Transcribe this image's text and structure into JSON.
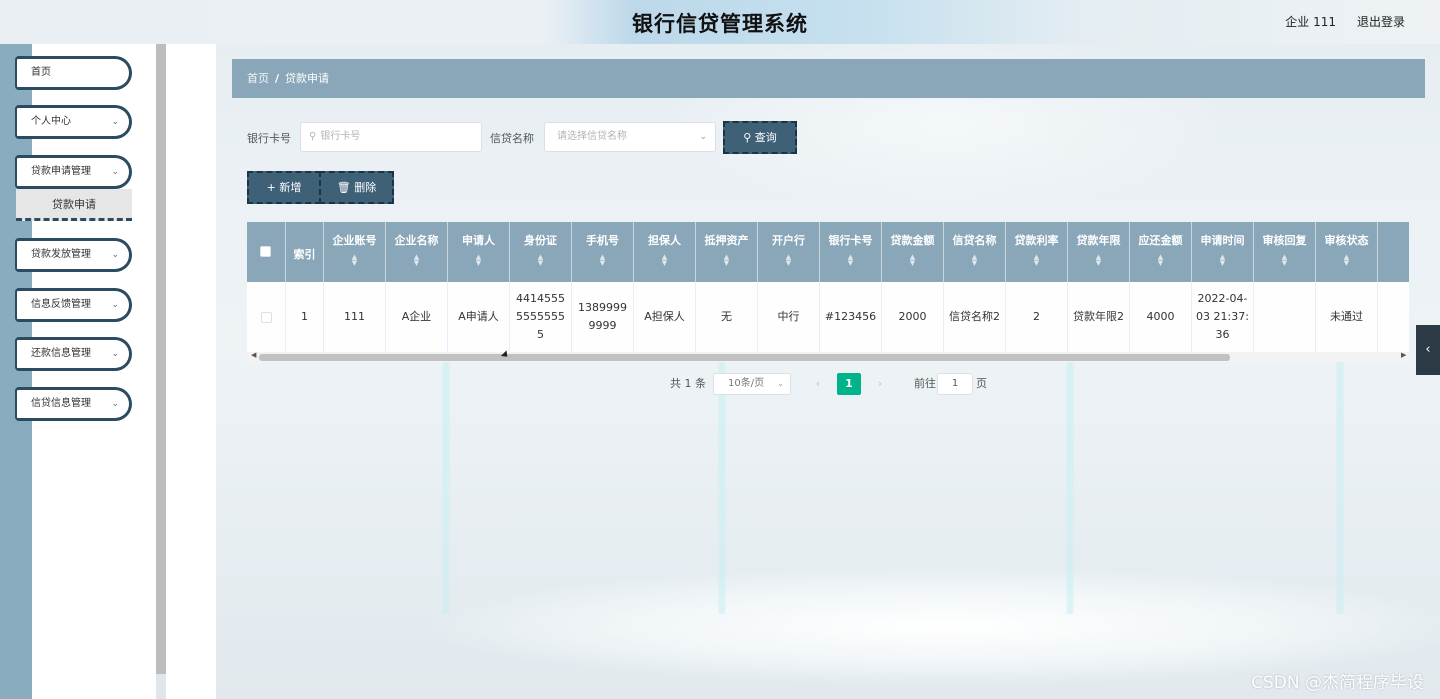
{
  "header": {
    "title": "银行信贷管理系统",
    "user": "企业 111",
    "logout": "退出登录"
  },
  "sidebar": {
    "items": [
      {
        "label": "首页",
        "chevron": false
      },
      {
        "label": "个人中心",
        "chevron": true
      },
      {
        "label": "贷款申请管理",
        "chevron": true
      },
      {
        "label": "贷款发放管理",
        "chevron": true
      },
      {
        "label": "信息反馈管理",
        "chevron": true
      },
      {
        "label": "还款信息管理",
        "chevron": true
      },
      {
        "label": "信贷信息管理",
        "chevron": true
      }
    ],
    "active_sub": "贷款申请"
  },
  "breadcrumb": {
    "home": "首页",
    "separator": "/",
    "current": "贷款申请"
  },
  "search": {
    "card_label": "银行卡号",
    "card_placeholder": "银行卡号",
    "credit_label": "信贷名称",
    "credit_placeholder": "请选择信贷名称",
    "query_button": "查询",
    "add_button": "新增",
    "delete_button": "删除"
  },
  "table": {
    "headers": [
      "索引",
      "企业账号",
      "企业名称",
      "申请人",
      "身份证",
      "手机号",
      "担保人",
      "抵押资产",
      "开户行",
      "银行卡号",
      "贷款金额",
      "信贷名称",
      "贷款利率",
      "贷款年限",
      "应还金额",
      "申请时间",
      "审核回复",
      "审核状态"
    ],
    "rows": [
      [
        "1",
        "111",
        "A企业",
        "A申请人",
        "441455555555555",
        "13899999999",
        "A担保人",
        "无",
        "中行",
        "#123456",
        "2000",
        "信贷名称2",
        "2",
        "贷款年限2",
        "4000",
        "2022-04-03 21:37:36",
        "",
        "未通过"
      ]
    ]
  },
  "pagination": {
    "total": "共 1 条",
    "page_size": "10条/页",
    "current_page": "1",
    "goto_label": "前往",
    "goto_value": "1",
    "page_suffix": "页"
  },
  "watermark": "CSDN @杰简程序毕设",
  "colors": {
    "header_bar": "#89a7b9",
    "sidebar_border": "#2b4b61",
    "active_page": "#00b38a",
    "button_dark": "#3e6178"
  }
}
